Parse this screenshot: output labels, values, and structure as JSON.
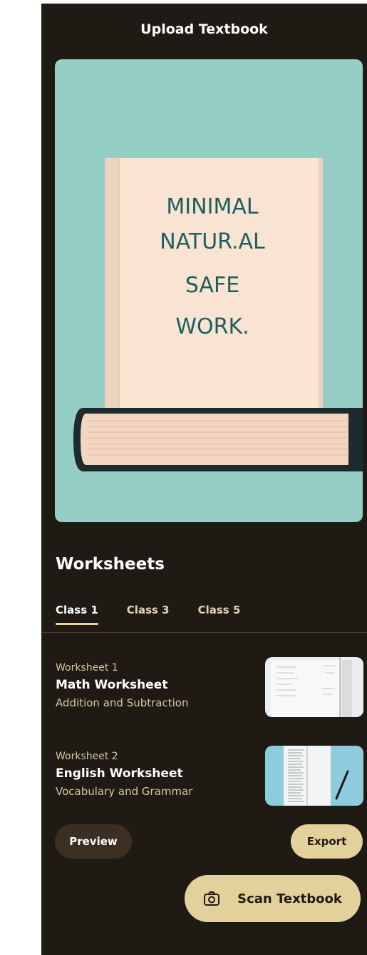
{
  "header": {
    "title": "Upload Textbook"
  },
  "hero": {
    "book_cover_lines": [
      "MINIMAL",
      "NATUR.AL",
      "SAFE",
      "WORK."
    ],
    "colors": {
      "background": "#95cec4",
      "cover": "#f9e3d3",
      "text": "#1f5e5e"
    }
  },
  "worksheets": {
    "section_title": "Worksheets",
    "tabs": [
      {
        "label": "Class 1",
        "active": true
      },
      {
        "label": "Class 3",
        "active": false
      },
      {
        "label": "Class 5",
        "active": false
      }
    ],
    "items": [
      {
        "number": "Worksheet 1",
        "title": "Math Worksheet",
        "subtitle": "Addition and Subtraction",
        "thumb": "math-sheet-icon"
      },
      {
        "number": "Worksheet 2",
        "title": "English Worksheet",
        "subtitle": "Vocabulary and Grammar",
        "thumb": "notebook-pen-icon"
      }
    ]
  },
  "actions": {
    "preview_label": "Preview",
    "export_label": "Export",
    "scan_label": "Scan Textbook"
  },
  "theme": {
    "background": "#201a15",
    "accent": "#e3d19c"
  }
}
